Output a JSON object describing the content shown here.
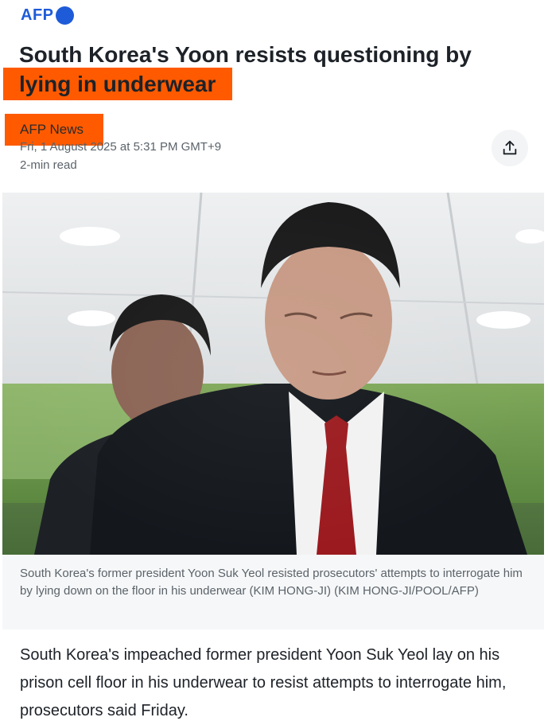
{
  "brand": {
    "name": "AFP"
  },
  "article": {
    "headline_line1": "South Korea's Yoon resists questioning by",
    "headline_line2": "lying in underwear",
    "source": "AFP News",
    "date": "Fri, 1 August 2025 at 5:31 PM GMT+9",
    "read_time": "2-min read",
    "share_icon": "share-icon",
    "image_caption": "South Korea's former president Yoon Suk Yeol resisted prosecutors' attempts to interrogate him by lying down on the floor in his underwear (KIM HONG-JI) (KIM HONG-JI/POOL/AFP)",
    "body": "South Korea's impeached former president Yoon Suk Yeol lay on his prison cell floor in his underwear to resist attempts to interrogate him, prosecutors said Friday."
  },
  "colors": {
    "brand_blue": "#1e5bd8",
    "highlight_orange": "#ff5a00",
    "text_dark": "#1d2228",
    "text_muted": "#5b636a"
  }
}
